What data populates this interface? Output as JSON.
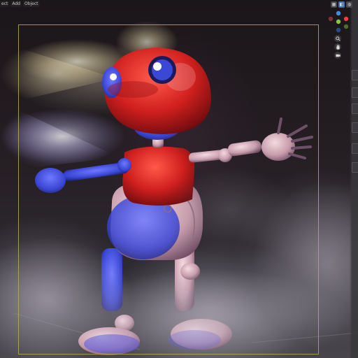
{
  "header": {
    "menu": [
      "ect",
      "Add",
      "Object"
    ]
  },
  "gizmo": {
    "axis_colors": {
      "x": "#e8413f",
      "y": "#8bc34a",
      "z": "#3d8fe0",
      "neg": "#7d3333"
    },
    "tools": [
      "view-mode-icon",
      "shading-toggle-icon",
      "overlay-toggle-icon"
    ],
    "nav": [
      "zoom-icon",
      "hand-pan-icon",
      "camera-view-icon"
    ]
  },
  "colors": {
    "camera_border": "#c4ab46",
    "robot_red": "#d1201f",
    "robot_blue": "#3b48d6",
    "robot_pink": "#cfa9b4"
  }
}
